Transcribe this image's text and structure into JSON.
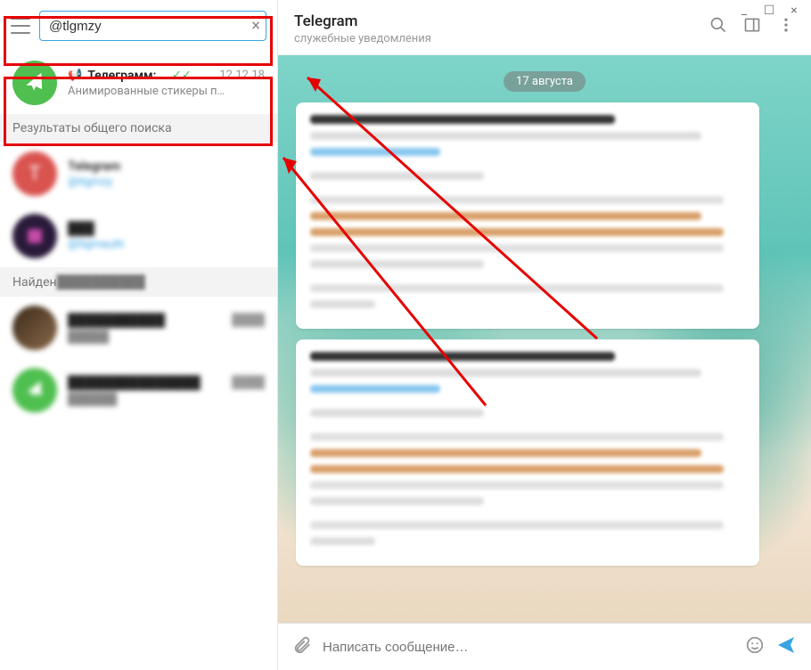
{
  "titlebar": {
    "min": "_",
    "max": "☐",
    "close": "×"
  },
  "search": {
    "value": "@tlgmzy",
    "clear": "×"
  },
  "top_chat": {
    "title": "Телеграмм: …",
    "verified_glyph": "✓✓",
    "date": "12.12.18",
    "subtitle": "Анимированные стикеры п…"
  },
  "sections": {
    "global": "Результаты общего поиска",
    "found": "Найден"
  },
  "global_results": [
    {
      "avatar_letter": "T",
      "title": "Telegram",
      "handle": "@tlgmzy"
    },
    {
      "title": "",
      "handle": "@tlgmauth"
    }
  ],
  "found_results": [
    {
      "title": "",
      "sub": ""
    },
    {
      "title": "",
      "sub": ""
    }
  ],
  "header": {
    "title": "Telegram",
    "subtitle": "служебные уведомления"
  },
  "date_badge": "17 августа",
  "composer": {
    "placeholder": "Написать сообщение…"
  }
}
